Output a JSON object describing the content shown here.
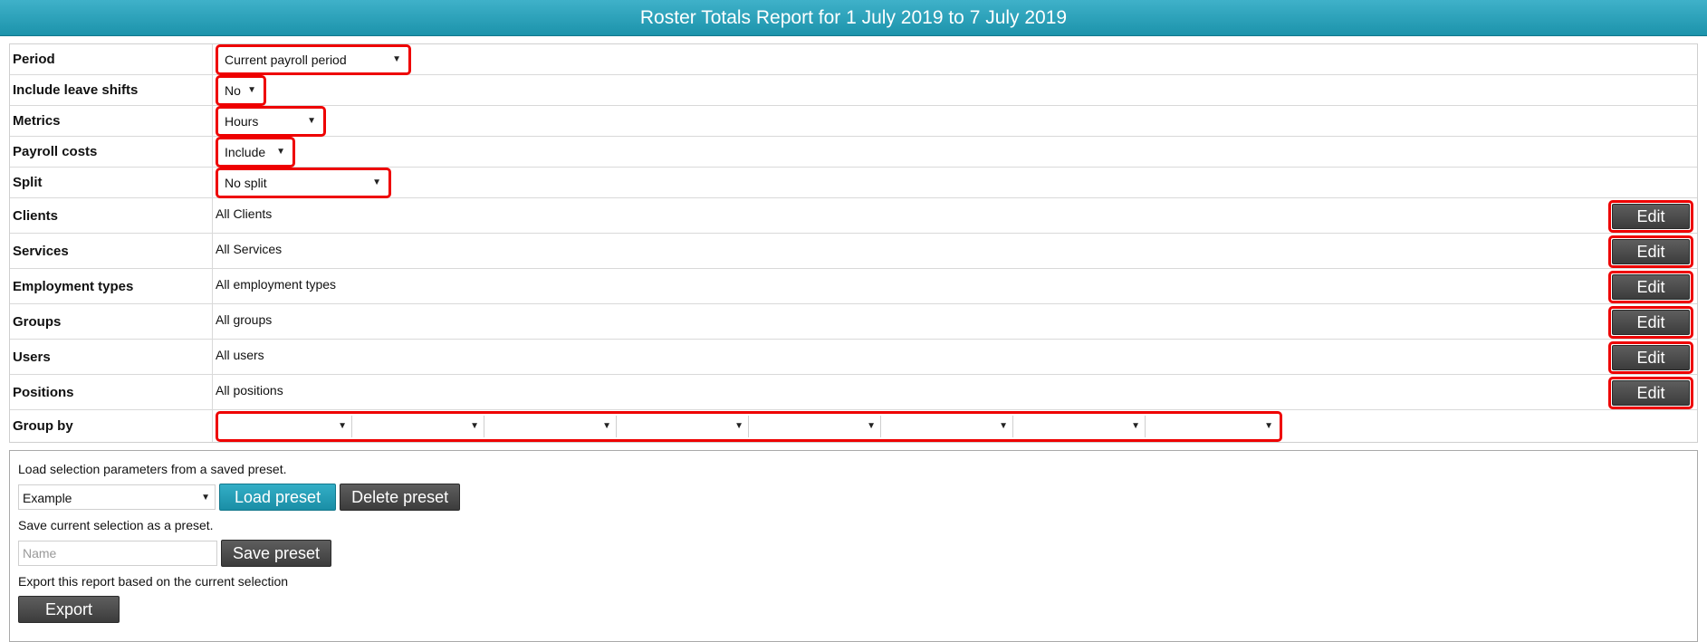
{
  "header": {
    "title": "Roster Totals Report for 1 July 2019 to 7 July 2019"
  },
  "params": {
    "period": {
      "label": "Period",
      "value": "Current payroll period"
    },
    "leave": {
      "label": "Include leave shifts",
      "value": "No"
    },
    "metrics": {
      "label": "Metrics",
      "value": "Hours"
    },
    "payroll": {
      "label": "Payroll costs",
      "value": "Include"
    },
    "split": {
      "label": "Split",
      "value": "No split"
    },
    "clients": {
      "label": "Clients",
      "value": "All Clients",
      "button": "Edit"
    },
    "services": {
      "label": "Services",
      "value": "All Services",
      "button": "Edit"
    },
    "employment": {
      "label": "Employment types",
      "value": "All employment types",
      "button": "Edit"
    },
    "groups": {
      "label": "Groups",
      "value": "All groups",
      "button": "Edit"
    },
    "users": {
      "label": "Users",
      "value": "All users",
      "button": "Edit"
    },
    "positions": {
      "label": "Positions",
      "value": "All positions",
      "button": "Edit"
    },
    "groupby": {
      "label": "Group by",
      "values": [
        "",
        "",
        "",
        "",
        "",
        "",
        "",
        ""
      ]
    }
  },
  "presets": {
    "load_text": "Load selection parameters from a saved preset.",
    "selected_preset": "Example",
    "load_button": "Load preset",
    "delete_button": "Delete preset",
    "save_text": "Save current selection as a preset.",
    "name_placeholder": "Name",
    "save_button": "Save preset",
    "export_text": "Export this report based on the current selection",
    "export_button": "Export"
  },
  "icons": {
    "dropdown_arrow": "▼"
  },
  "colors": {
    "header_bg": "#2aa3bc",
    "highlight": "#ee0000",
    "button_dark": "#4a4a4a",
    "button_teal": "#2196ad"
  }
}
